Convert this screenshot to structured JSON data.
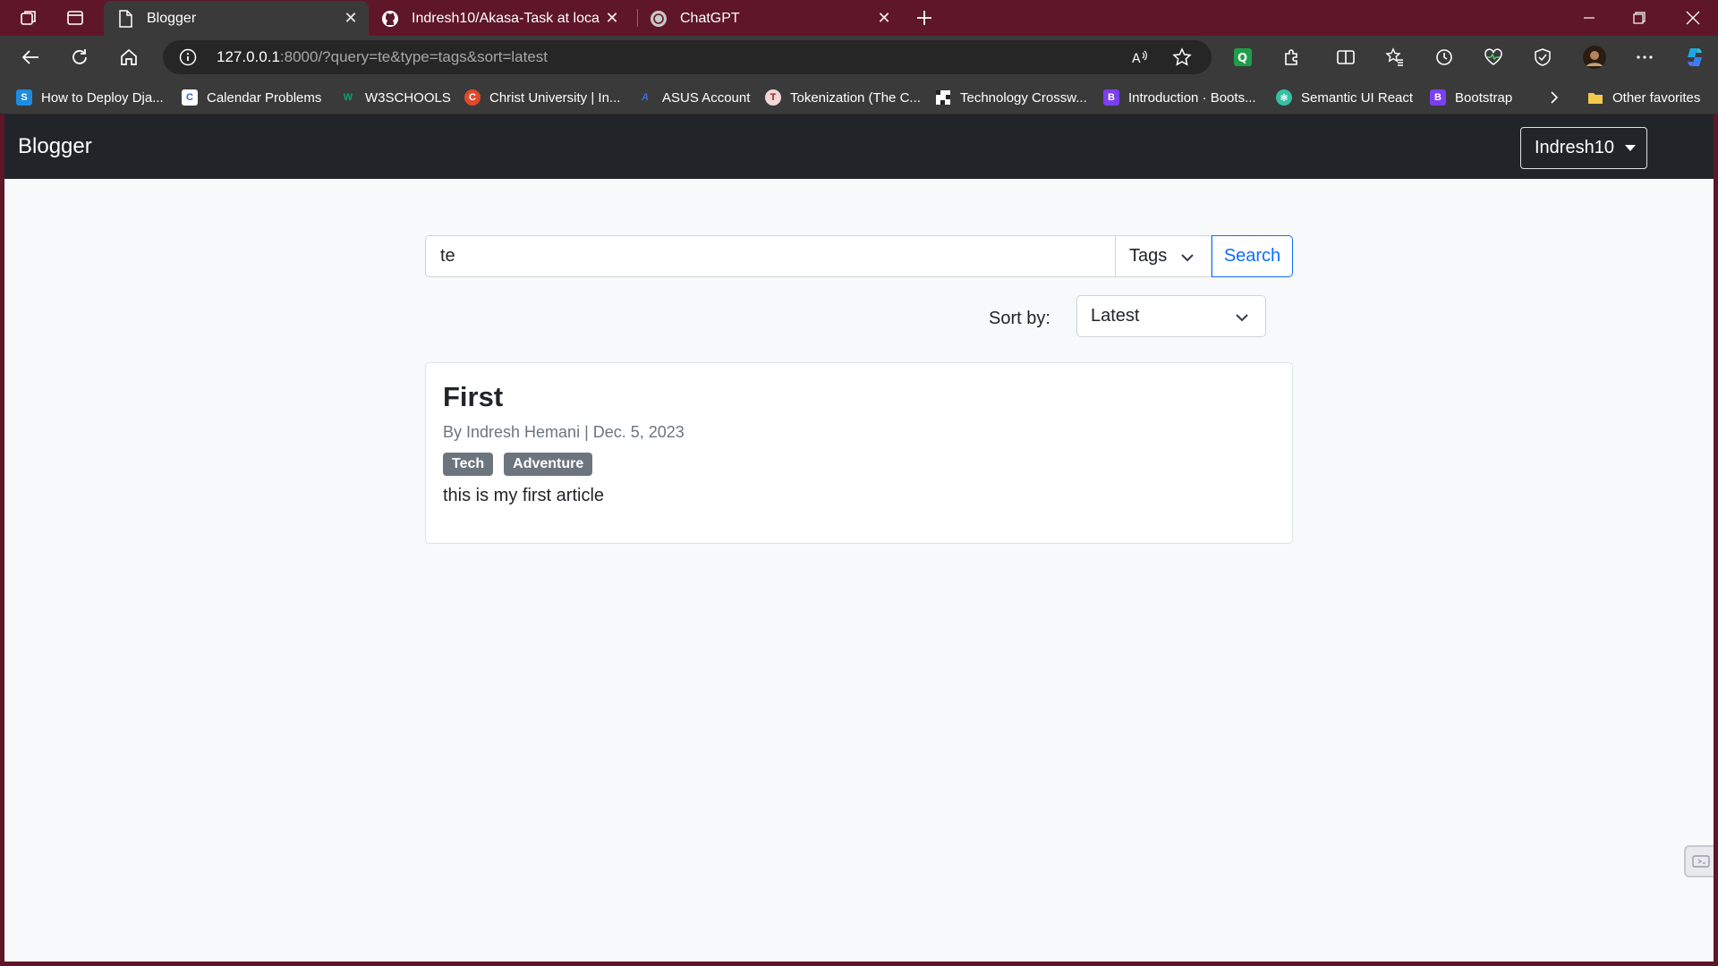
{
  "browser": {
    "tabs": [
      {
        "title": "Blogger",
        "active": true
      },
      {
        "title": "Indresh10/Akasa-Task at local",
        "active": false
      },
      {
        "title": "ChatGPT",
        "active": false
      }
    ],
    "address": {
      "host": "127.0.0.1",
      "rest": ":8000/?query=te&type=tags&sort=latest"
    },
    "bookmarks": [
      "How to Deploy Dja...",
      "Calendar Problems",
      "W3SCHOOLS",
      "Christ University | In...",
      "ASUS Account",
      "Tokenization (The C...",
      "Technology Crossw...",
      "Introduction · Boots...",
      "Semantic UI React",
      "Bootstrap",
      "Other favorites"
    ],
    "profile_extension_label": "Q"
  },
  "navbar": {
    "brand": "Blogger",
    "user": "Indresh10"
  },
  "search": {
    "query": "te",
    "type": "Tags",
    "button": "Search"
  },
  "sort": {
    "label": "Sort by:",
    "value": "Latest"
  },
  "posts": [
    {
      "title": "First",
      "meta": "By Indresh Hemani | Dec. 5, 2023",
      "tags": [
        "Tech",
        "Adventure"
      ],
      "body": "this is my first article"
    }
  ],
  "colors": {
    "frame": "#5f1628",
    "accent": "#0d6efd",
    "navbar": "#212529",
    "badge": "#6c757d"
  }
}
